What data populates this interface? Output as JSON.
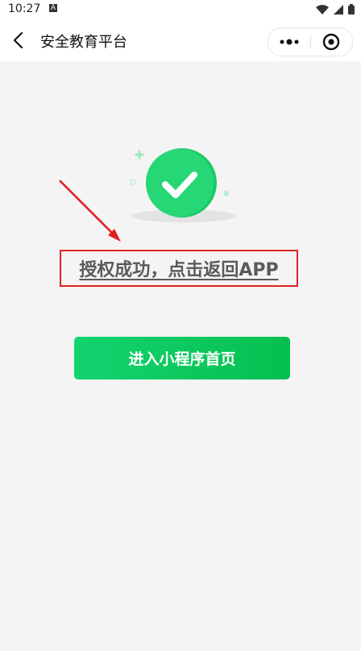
{
  "status_bar": {
    "time": "10:27",
    "notification_letter": "A",
    "icons": [
      "wifi-icon",
      "cellular-signal-icon",
      "battery-icon"
    ]
  },
  "nav": {
    "title": "安全教育平台",
    "back_icon": "chevron-left-icon",
    "more_icon": "more-dots-icon",
    "close_icon": "target-circle-icon"
  },
  "illustration": {
    "icon": "success-check-icon",
    "accent_color": "#1fc86a"
  },
  "message": {
    "text": "授权成功，点击返回APP",
    "highlight_color": "#e22222"
  },
  "buttons": {
    "enter_label": "进入小程序首页"
  },
  "colors": {
    "primary": "#07c160",
    "background": "#f4f4f4"
  }
}
